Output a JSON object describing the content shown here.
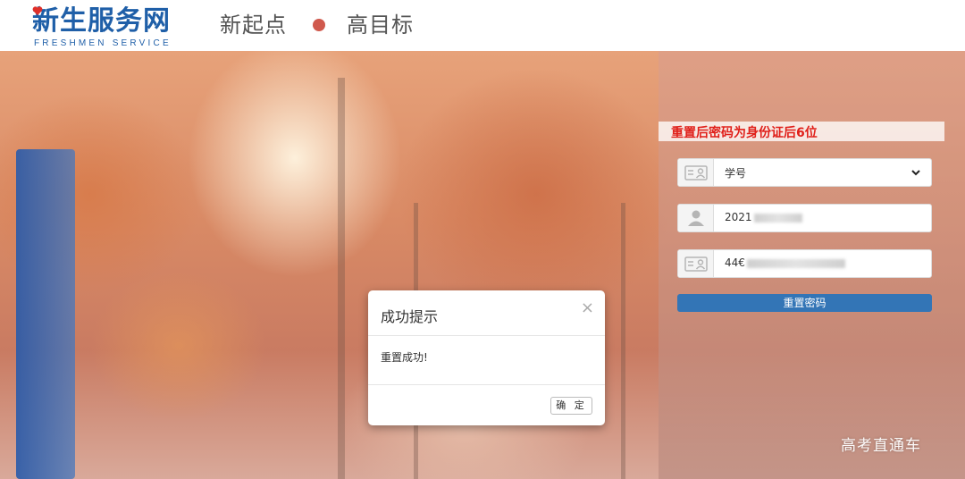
{
  "header": {
    "logo_text": "新生服务网",
    "logo_subtext": "FRESHMEN SERVICE",
    "slogan_left": "新起点",
    "slogan_right": "高目标"
  },
  "form": {
    "notice": "重置后密码为身份证后6位",
    "id_type_select": {
      "selected": "学号",
      "icon": "id-card-icon"
    },
    "student_id": {
      "value": "2021",
      "icon": "user-icon"
    },
    "id_number": {
      "value": "44€",
      "icon": "id-card-icon"
    },
    "reset_button_label": "重置密码"
  },
  "modal": {
    "title": "成功提示",
    "close_symbol": "×",
    "message": "重置成功!",
    "ok_label": "确 定"
  },
  "watermark": "高考直通车",
  "colors": {
    "brand_blue": "#1f5fa8",
    "notice_red": "#e0201a",
    "button_blue": "#3375b6",
    "dot_red": "#d0594d"
  }
}
